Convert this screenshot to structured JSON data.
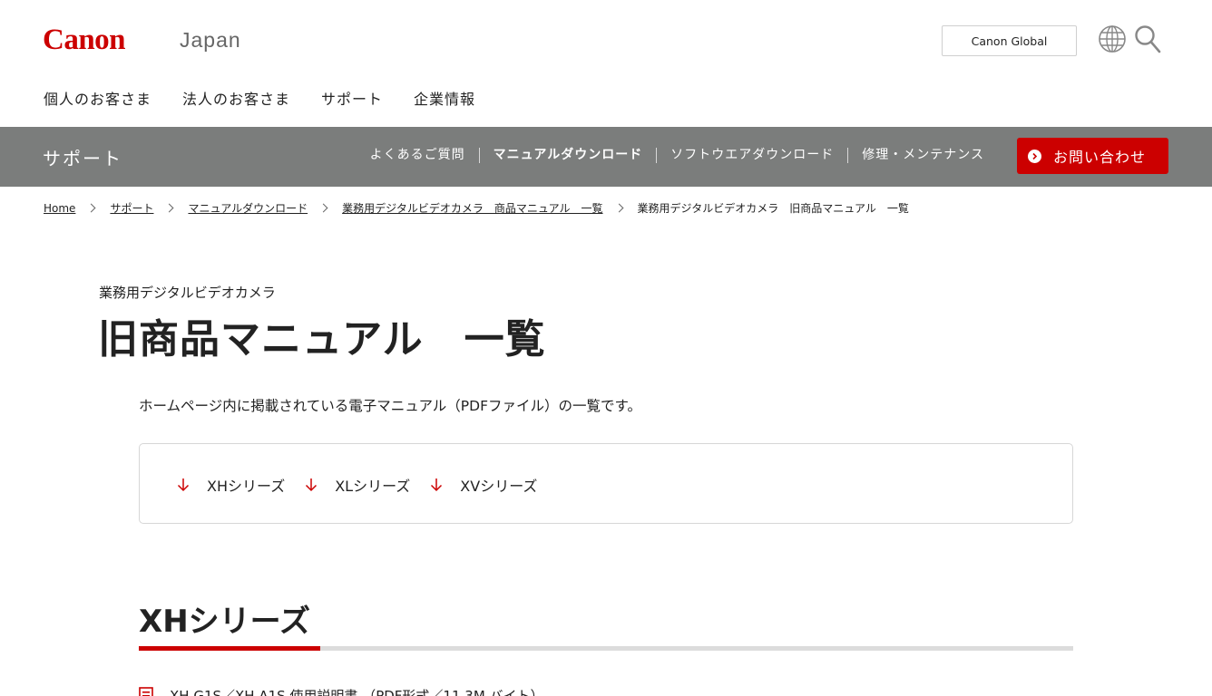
{
  "header": {
    "logo": "Canon",
    "region": "Japan",
    "global_button": "Canon Global",
    "nav": [
      "個人のお客さま",
      "法人のお客さま",
      "サポート",
      "企業情報"
    ]
  },
  "support_bar": {
    "title": "サポート",
    "items": [
      "よくあるご質問",
      "マニュアルダウンロード",
      "ソフトウエアダウンロード",
      "修理・メンテナンス"
    ],
    "contact_button": "お問い合わせ"
  },
  "breadcrumb": {
    "links": [
      "Home",
      "サポート",
      "マニュアルダウンロード",
      "業務用デジタルビデオカメラ　商品マニュアル　一覧"
    ],
    "current": "業務用デジタルビデオカメラ　旧商品マニュアル　一覧"
  },
  "content": {
    "eyebrow": "業務用デジタルビデオカメラ",
    "title": "旧商品マニュアル　一覧",
    "intro": "ホームページ内に掲載されている電子マニュアル（PDFファイル）の一覧です。",
    "anchors": [
      "XHシリーズ",
      "XLシリーズ",
      "XVシリーズ"
    ],
    "section_title": "XHシリーズ",
    "first_doc": "XH G1S／XH A1S 使用説明書 （PDF形式／11.3M バイト）"
  },
  "colors": {
    "brand_red": "#cc0000",
    "support_gray": "#7b7d7c"
  }
}
